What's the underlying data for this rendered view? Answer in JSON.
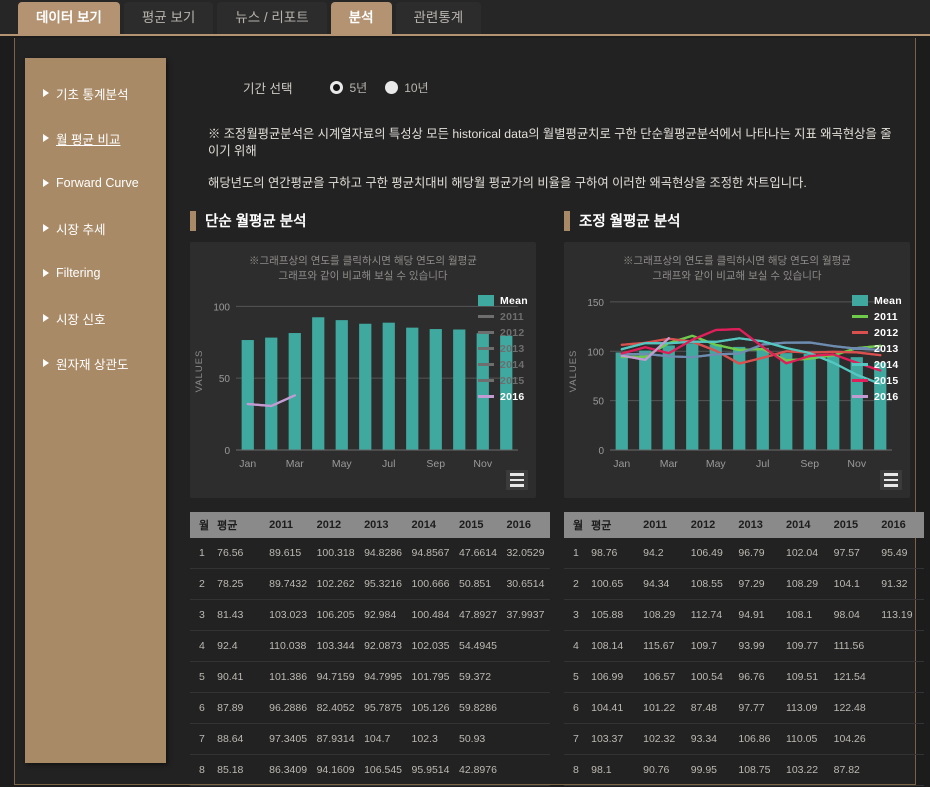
{
  "tabs": [
    {
      "label": "데이터 보기",
      "active": true
    },
    {
      "label": "평균 보기",
      "active": false
    },
    {
      "label": "뉴스 / 리포트",
      "active": false
    },
    {
      "label": "분석",
      "active": true
    },
    {
      "label": "관련통계",
      "active": false
    }
  ],
  "sidebar": {
    "items": [
      {
        "label": "기초 통계분석",
        "selected": false
      },
      {
        "label": "월 평균 비교",
        "selected": true
      },
      {
        "label": "Forward Curve",
        "selected": false
      },
      {
        "label": "시장 추세",
        "selected": false
      },
      {
        "label": "Filtering",
        "selected": false
      },
      {
        "label": "시장 신호",
        "selected": false
      },
      {
        "label": "원자재 상관도",
        "selected": false
      }
    ]
  },
  "period": {
    "label": "기간 선택",
    "options": [
      {
        "label": "5년",
        "selected": true
      },
      {
        "label": "10년",
        "selected": false
      }
    ]
  },
  "note": {
    "line1": "※ 조정월평균분석은 시계열자료의 특성상 모든 historical data의 월별평균치로 구한 단순월평균분석에서 나타나는 지표 왜곡현상을 줄이기 위해",
    "line2": "해당년도의 연간평균을 구하고 구한 평균치대비 해당월 평균가의 비율을 구하여 이러한 왜곡현상을 조정한 차트입니다."
  },
  "left_panel": {
    "title": "단순 월평균 분석",
    "chart_note_line1": "※그래프상의 연도를 클릭하시면 해당 연도의 월평균",
    "chart_note_line2": "그래프와 같이 비교해 보실 수 있습니다",
    "burger_icon": "hamburger-menu-icon"
  },
  "right_panel": {
    "title": "조정 월평균 분석",
    "chart_note_line1": "※그래프상의 연도를 클릭하시면 해당 연도의 월평균",
    "chart_note_line2": "그래프와 같이 비교해 보실 수 있습니다",
    "burger_icon": "hamburger-menu-icon"
  },
  "colors": {
    "mean": "#3fa9a0",
    "y2011": "#6fca4c",
    "y2012": "#d9504f",
    "y2013": "#6d8cb0",
    "y2014": "#54c8c0",
    "y2015": "#e01e5a",
    "y2016": "#c39bd3",
    "inactive": "#6e6e6e",
    "accent": "#a98a67"
  },
  "chart_data": [
    {
      "id": "simple-monthly-average-chart",
      "type": "bar",
      "title": "단순 월평균 분석",
      "xlabel": "",
      "ylabel": "Values",
      "ylim": [
        0,
        110
      ],
      "yticks": [
        0,
        50,
        100
      ],
      "grid": true,
      "legend_position": "top-right",
      "categories": [
        "Jan",
        "Feb",
        "Mar",
        "Apr",
        "May",
        "Jun",
        "Jul",
        "Aug",
        "Sep",
        "Oct",
        "Nov",
        "Dec"
      ],
      "xtick_labels": [
        "Jan",
        "Mar",
        "May",
        "Jul",
        "Sep",
        "Nov"
      ],
      "bars": {
        "name": "Mean",
        "color": "#3fa9a0",
        "values": [
          76.56,
          78.25,
          81.43,
          92.4,
          90.41,
          87.89,
          88.64,
          85.18,
          84.2,
          83.9,
          81.3,
          79.6
        ]
      },
      "series": [
        {
          "name": "2011",
          "color": "#6e6e6e",
          "active": false,
          "values": [
            89.615,
            89.7432,
            103.023,
            110.038,
            101.386,
            96.2886,
            97.3405,
            86.3409,
            null,
            null,
            null,
            null
          ]
        },
        {
          "name": "2012",
          "color": "#6e6e6e",
          "active": false,
          "values": [
            100.318,
            102.262,
            106.205,
            103.344,
            94.7159,
            82.4052,
            87.9314,
            94.1609,
            null,
            null,
            null,
            null
          ]
        },
        {
          "name": "2013",
          "color": "#6e6e6e",
          "active": false,
          "values": [
            94.8286,
            95.3216,
            92.984,
            92.0873,
            94.7995,
            95.7875,
            104.7,
            106.545,
            null,
            null,
            null,
            null
          ]
        },
        {
          "name": "2014",
          "color": "#6e6e6e",
          "active": false,
          "values": [
            94.8567,
            100.666,
            100.484,
            102.035,
            101.795,
            105.126,
            102.3,
            95.9514,
            null,
            null,
            null,
            null
          ]
        },
        {
          "name": "2015",
          "color": "#6e6e6e",
          "active": false,
          "values": [
            47.6614,
            50.851,
            47.8927,
            54.4945,
            59.372,
            59.8286,
            50.93,
            42.8976,
            null,
            null,
            null,
            null
          ]
        },
        {
          "name": "2016",
          "color": "#c39bd3",
          "active": true,
          "values": [
            32.0529,
            30.6514,
            37.9937,
            null,
            null,
            null,
            null,
            null,
            null,
            null,
            null,
            null
          ]
        }
      ]
    },
    {
      "id": "adjusted-monthly-average-chart",
      "type": "bar",
      "title": "조정 월평균 분석",
      "xlabel": "",
      "ylabel": "Values",
      "ylim": [
        0,
        160
      ],
      "yticks": [
        0,
        50,
        100,
        150
      ],
      "grid": true,
      "legend_position": "top-right",
      "categories": [
        "Jan",
        "Feb",
        "Mar",
        "Apr",
        "May",
        "Jun",
        "Jul",
        "Aug",
        "Sep",
        "Oct",
        "Nov",
        "Dec"
      ],
      "xtick_labels": [
        "Jan",
        "Mar",
        "May",
        "Jul",
        "Sep",
        "Nov"
      ],
      "bars": {
        "name": "Mean",
        "color": "#3fa9a0",
        "values": [
          98.76,
          100.65,
          105.88,
          108.14,
          106.99,
          104.41,
          103.37,
          98.1,
          97.4,
          96.2,
          94.0,
          88.5
        ]
      },
      "series": [
        {
          "name": "2011",
          "color": "#6fca4c",
          "active": true,
          "values": [
            94.2,
            94.34,
            108.29,
            115.67,
            106.57,
            101.22,
            102.32,
            90.76,
            92.5,
            95.8,
            103.2,
            105.4
          ]
        },
        {
          "name": "2012",
          "color": "#d9504f",
          "active": true,
          "values": [
            106.49,
            108.55,
            112.74,
            109.7,
            100.54,
            87.48,
            93.34,
            99.95,
            98.6,
            99.4,
            98.8,
            96.0
          ]
        },
        {
          "name": "2013",
          "color": "#6d8cb0",
          "active": true,
          "values": [
            96.79,
            97.29,
            94.91,
            93.99,
            96.76,
            97.77,
            106.86,
            108.75,
            108.9,
            105.2,
            102.6,
            101.5
          ]
        },
        {
          "name": "2014",
          "color": "#54c8c0",
          "active": true,
          "values": [
            102.04,
            108.29,
            108.1,
            109.77,
            109.51,
            113.09,
            110.05,
            103.22,
            98.1,
            88.4,
            76.2,
            66.8
          ]
        },
        {
          "name": "2015",
          "color": "#e01e5a",
          "active": true,
          "values": [
            97.57,
            104.1,
            98.04,
            111.56,
            121.54,
            122.48,
            104.26,
            87.82,
            95.2,
            96.8,
            88.4,
            80.5
          ]
        },
        {
          "name": "2016",
          "color": "#c39bd3",
          "active": true,
          "values": [
            95.49,
            91.32,
            113.19,
            null,
            null,
            null,
            null,
            null,
            null,
            null,
            null,
            null
          ]
        }
      ]
    }
  ],
  "left_table": {
    "headers": [
      "월",
      "평균",
      "2011",
      "2012",
      "2013",
      "2014",
      "2015",
      "2016"
    ],
    "rows": [
      [
        "1",
        "76.56",
        "89.615",
        "100.318",
        "94.8286",
        "94.8567",
        "47.6614",
        "32.0529"
      ],
      [
        "2",
        "78.25",
        "89.7432",
        "102.262",
        "95.3216",
        "100.666",
        "50.851",
        "30.6514"
      ],
      [
        "3",
        "81.43",
        "103.023",
        "106.205",
        "92.984",
        "100.484",
        "47.8927",
        "37.9937"
      ],
      [
        "4",
        "92.4",
        "110.038",
        "103.344",
        "92.0873",
        "102.035",
        "54.4945",
        ""
      ],
      [
        "5",
        "90.41",
        "101.386",
        "94.7159",
        "94.7995",
        "101.795",
        "59.372",
        ""
      ],
      [
        "6",
        "87.89",
        "96.2886",
        "82.4052",
        "95.7875",
        "105.126",
        "59.8286",
        ""
      ],
      [
        "7",
        "88.64",
        "97.3405",
        "87.9314",
        "104.7",
        "102.3",
        "50.93",
        ""
      ],
      [
        "8",
        "85.18",
        "86.3409",
        "94.1609",
        "106.545",
        "95.9514",
        "42.8976",
        ""
      ]
    ]
  },
  "right_table": {
    "headers": [
      "월",
      "평균",
      "2011",
      "2012",
      "2013",
      "2014",
      "2015",
      "2016"
    ],
    "rows": [
      [
        "1",
        "98.76",
        "94.2",
        "106.49",
        "96.79",
        "102.04",
        "97.57",
        "95.49"
      ],
      [
        "2",
        "100.65",
        "94.34",
        "108.55",
        "97.29",
        "108.29",
        "104.1",
        "91.32"
      ],
      [
        "3",
        "105.88",
        "108.29",
        "112.74",
        "94.91",
        "108.1",
        "98.04",
        "113.19"
      ],
      [
        "4",
        "108.14",
        "115.67",
        "109.7",
        "93.99",
        "109.77",
        "111.56",
        ""
      ],
      [
        "5",
        "106.99",
        "106.57",
        "100.54",
        "96.76",
        "109.51",
        "121.54",
        ""
      ],
      [
        "6",
        "104.41",
        "101.22",
        "87.48",
        "97.77",
        "113.09",
        "122.48",
        ""
      ],
      [
        "7",
        "103.37",
        "102.32",
        "93.34",
        "106.86",
        "110.05",
        "104.26",
        ""
      ],
      [
        "8",
        "98.1",
        "90.76",
        "99.95",
        "108.75",
        "103.22",
        "87.82",
        ""
      ]
    ]
  }
}
